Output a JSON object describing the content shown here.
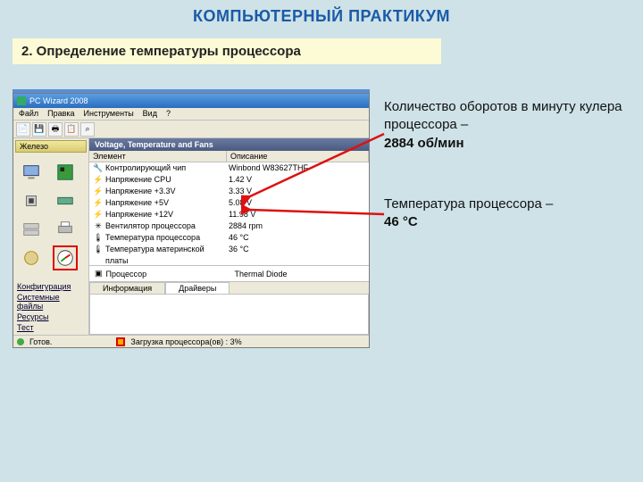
{
  "slide": {
    "title": "КОМПЬЮТЕРНЫЙ ПРАКТИКУМ",
    "task": "2. Определение температуры процессора"
  },
  "callouts": {
    "rpm_text": "Количество оборотов в минуту кулера процессора – ",
    "rpm_value": "2884 об/мин",
    "temp_text": "Температура процессора – ",
    "temp_value": "46 °C"
  },
  "win": {
    "title": "PC Wizard 2008",
    "menu": [
      "Файл",
      "Правка",
      "Инструменты",
      "Вид",
      "?"
    ],
    "side_tab": "Железо",
    "side_links": [
      "Конфигурация",
      "Системные файлы",
      "Ресурсы",
      "Тест"
    ],
    "panel_title": "Voltage, Temperature and Fans",
    "col1": "Элемент",
    "col2": "Описание",
    "rows": [
      {
        "icon": "🔧",
        "label": "Контролирующий чип",
        "value": "Winbond W83627THF"
      },
      {
        "icon": "⚡",
        "label": "Напряжение CPU",
        "value": "1.42 V"
      },
      {
        "icon": "⚡",
        "label": "Напряжение +3.3V",
        "value": "3.33 V"
      },
      {
        "icon": "⚡",
        "label": "Напряжение +5V",
        "value": "5.08 V"
      },
      {
        "icon": "⚡",
        "label": "Напряжение +12V",
        "value": "11.98 V"
      },
      {
        "icon": "✳",
        "label": "Вентилятор процессора",
        "value": "2884 rpm"
      },
      {
        "icon": "🌡",
        "label": "Температура процессора",
        "value": "46 °C"
      },
      {
        "icon": "🌡",
        "label": "Температура материнской платы",
        "value": "36 °C"
      }
    ],
    "proc_row": {
      "icon": "▣",
      "label": "Процессор",
      "value": "Thermal Diode"
    },
    "tabs": [
      "Информация",
      "Драйверы"
    ],
    "status_ready": "Готов.",
    "status_load": "Загрузка процессора(ов) : 3%"
  }
}
